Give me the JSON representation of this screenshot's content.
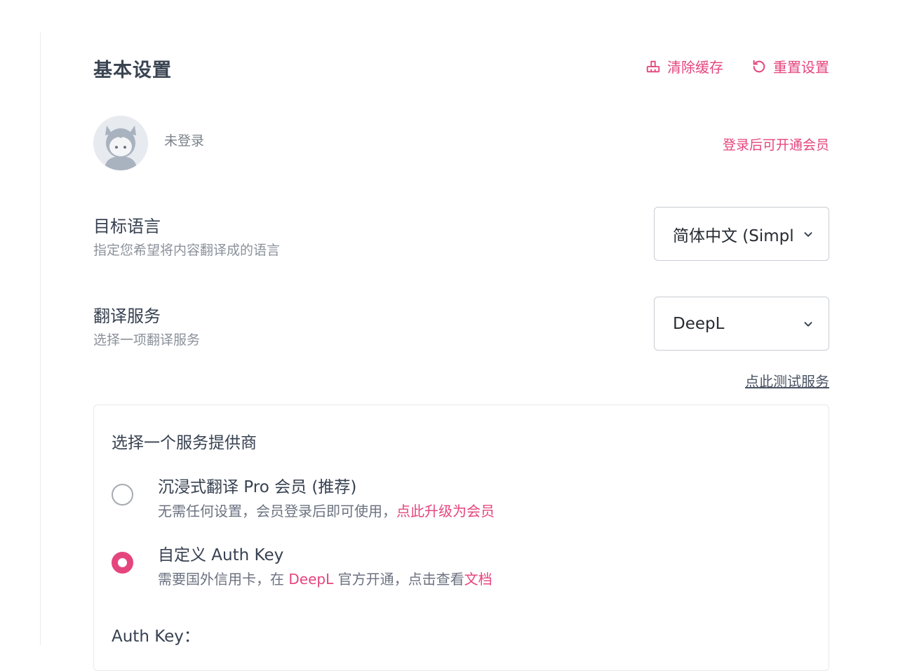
{
  "header": {
    "title": "基本设置",
    "clear_cache_label": "清除缓存",
    "reset_label": "重置设置"
  },
  "account": {
    "status": "未登录",
    "membership_link": "登录后可开通会员"
  },
  "target_language": {
    "label": "目标语言",
    "description": "指定您希望将内容翻译成的语言",
    "selected": "简体中文 (Simplified Chinese)"
  },
  "translation_service": {
    "label": "翻译服务",
    "description": "选择一项翻译服务",
    "selected": "DeepL",
    "test_link": "点此测试服务"
  },
  "provider": {
    "title": "选择一个服务提供商",
    "options": [
      {
        "title": "沉浸式翻译 Pro 会员 (推荐)",
        "desc_prefix": "无需任何设置，会员登录后即可使用，",
        "desc_link": "点此升级为会员",
        "checked": false
      },
      {
        "title": "自定义 Auth Key",
        "desc_prefix": "需要国外信用卡，在 ",
        "desc_link": "DeepL",
        "desc_middle": " 官方开通，点击查看",
        "desc_link2": "文档",
        "checked": true
      }
    ],
    "auth_key_label": "Auth Key："
  },
  "colors": {
    "accent": "#e5457d",
    "text": "#374151",
    "muted": "#8b929b"
  },
  "icons": [
    "broom-icon",
    "reset-icon",
    "avatar-icon",
    "chevron-down-icon"
  ]
}
